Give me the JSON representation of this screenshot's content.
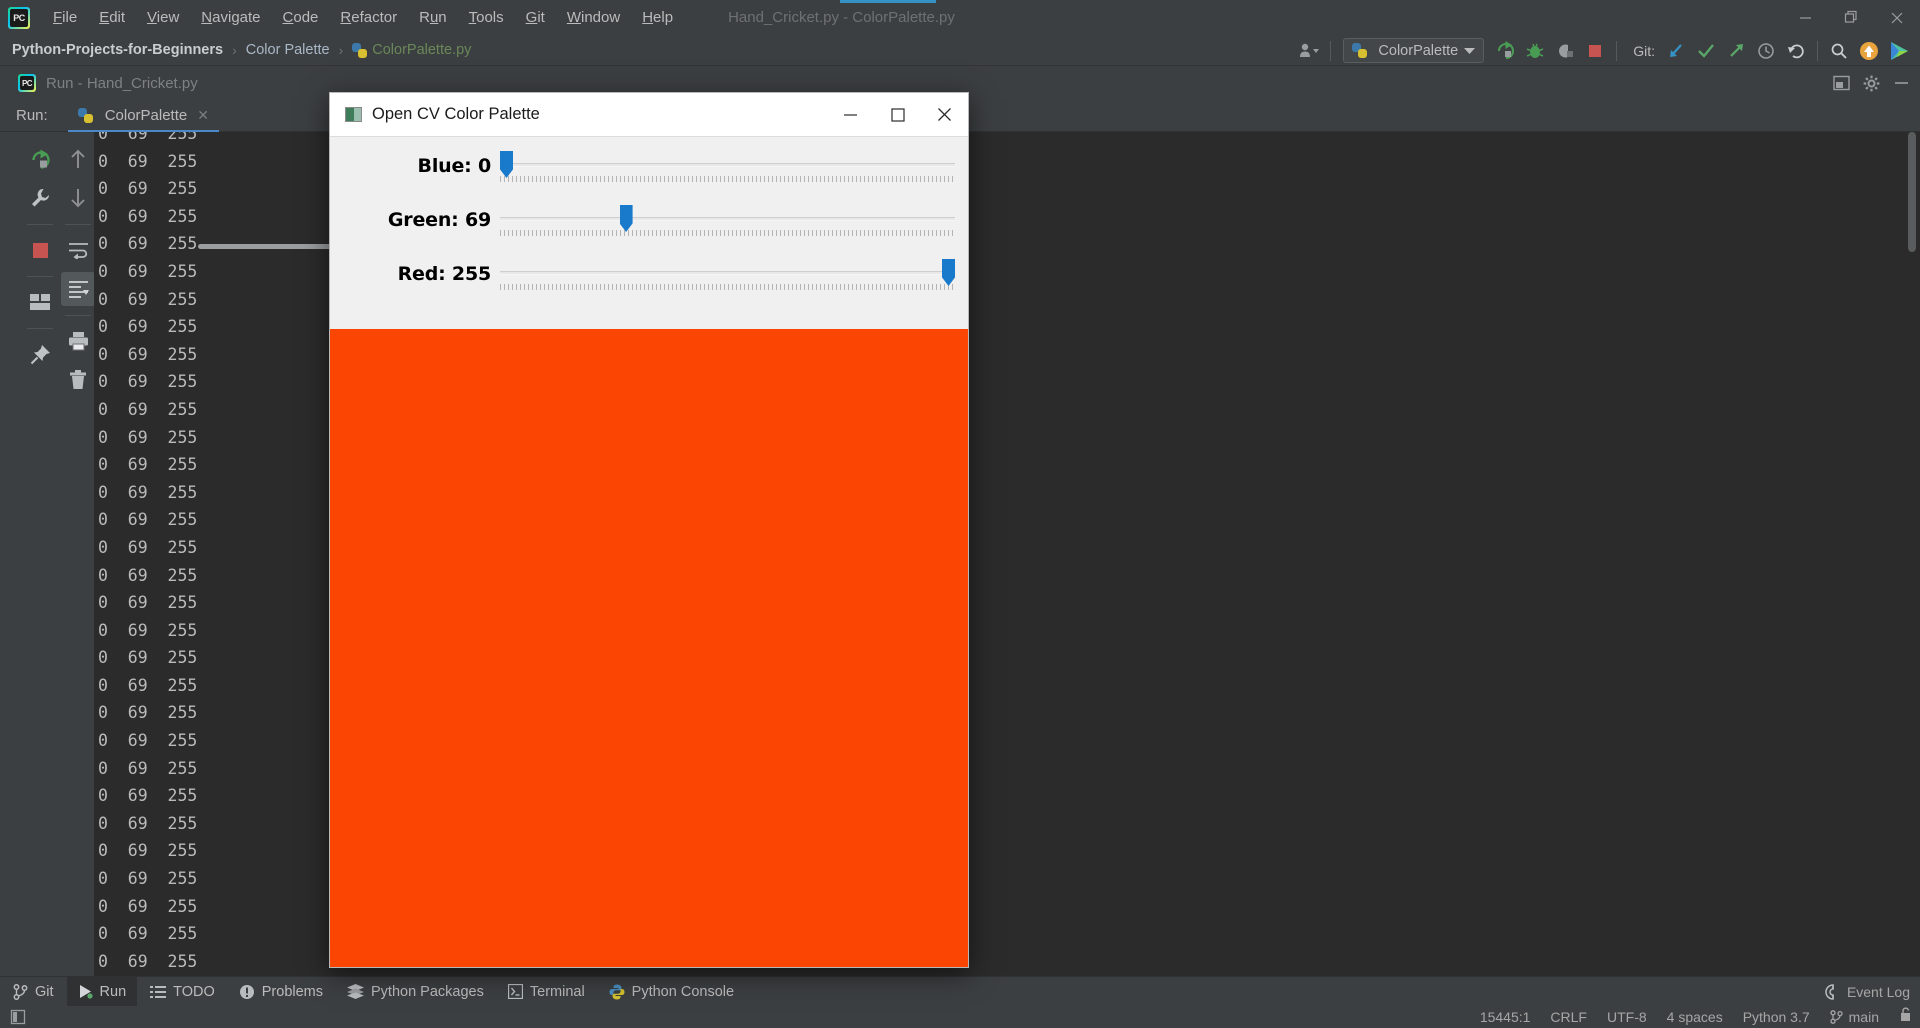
{
  "app": {
    "window_title": "Hand_Cricket.py - ColorPalette.py",
    "logo_text": "PC"
  },
  "menubar": {
    "items": [
      {
        "label": "File",
        "mnemonic": "F"
      },
      {
        "label": "Edit",
        "mnemonic": "E"
      },
      {
        "label": "View",
        "mnemonic": "V"
      },
      {
        "label": "Navigate",
        "mnemonic": "N"
      },
      {
        "label": "Code",
        "mnemonic": "C"
      },
      {
        "label": "Refactor",
        "mnemonic": "R"
      },
      {
        "label": "Run",
        "mnemonic": "u"
      },
      {
        "label": "Tools",
        "mnemonic": "T"
      },
      {
        "label": "Git",
        "mnemonic": "G"
      },
      {
        "label": "Window",
        "mnemonic": "W"
      },
      {
        "label": "Help",
        "mnemonic": "H"
      }
    ],
    "window_controls": {
      "minimize": "minimize-icon",
      "restore": "restore-icon",
      "close": "close-icon"
    }
  },
  "navbar": {
    "breadcrumbs": [
      {
        "label": "Python-Projects-for-Beginners",
        "kind": "project"
      },
      {
        "label": "Color Palette",
        "kind": "folder"
      },
      {
        "label": "ColorPalette.py",
        "kind": "file"
      }
    ],
    "separator": "›",
    "run_configuration": {
      "name": "ColorPalette",
      "icon": "python-file-icon",
      "dropdown": "chevron-down-icon"
    },
    "profile_icon": "user-settings-icon",
    "actions": [
      {
        "name": "run-button",
        "icon": "run-icon"
      },
      {
        "name": "debug-button",
        "icon": "bug-icon"
      },
      {
        "name": "run-with-coverage-button",
        "icon": "coverage-icon"
      },
      {
        "name": "stop-button",
        "icon": "stop-icon"
      }
    ],
    "git_label": "Git:",
    "git_actions": [
      {
        "name": "git-update-button",
        "icon": "update-project-icon"
      },
      {
        "name": "git-commit-button",
        "icon": "commit-icon"
      },
      {
        "name": "git-push-button",
        "icon": "push-icon"
      },
      {
        "name": "git-history-button",
        "icon": "history-icon"
      },
      {
        "name": "git-rollback-button",
        "icon": "rollback-icon"
      }
    ],
    "search_icon": "search-icon",
    "updates_icon": "update-available-icon",
    "ide_features_icon": "ide-features-trainer-icon"
  },
  "run_tool_window": {
    "header_title": "Run - Hand_Cricket.py",
    "header_icons": [
      {
        "name": "hide-tool-window-button",
        "icon": "hide-icon"
      },
      {
        "name": "settings-button",
        "icon": "gear-icon"
      },
      {
        "name": "minimize-tool-window-button",
        "icon": "minimize-icon"
      }
    ],
    "run_label": "Run:",
    "tabs": [
      {
        "label": "ColorPalette",
        "icon": "python-file-icon",
        "active": true,
        "close": "close-icon"
      }
    ],
    "left_toolbar_1": [
      {
        "name": "rerun-button",
        "icon": "rerun-icon"
      },
      {
        "name": "modify-run-configuration-button",
        "icon": "wrench-icon"
      },
      {
        "name": "stop-button",
        "icon": "stop-square-icon"
      },
      {
        "name": "restore-layout-button",
        "icon": "layout-icon"
      },
      {
        "name": "pin-tab-button",
        "icon": "pin-icon"
      }
    ],
    "left_toolbar_2": [
      {
        "name": "up-the-stack-button",
        "icon": "arrow-up-icon"
      },
      {
        "name": "down-the-stack-button",
        "icon": "arrow-down-icon"
      },
      {
        "name": "soft-wrap-button",
        "icon": "soft-wrap-icon"
      },
      {
        "name": "scroll-to-end-button",
        "icon": "scroll-to-end-icon",
        "selected": true
      },
      {
        "name": "print-button",
        "icon": "print-icon"
      },
      {
        "name": "clear-all-button",
        "icon": "trash-icon"
      }
    ],
    "console": {
      "line_text": "0  69  255",
      "line_count": 31,
      "partial_first_line": "0  69  255"
    }
  },
  "cv_window": {
    "title": "Open CV Color Palette",
    "icon": "opencv-window-icon",
    "controls": {
      "minimize": "─",
      "maximize": "☐",
      "close": "✕"
    },
    "trackbars": [
      {
        "name": "blue",
        "label": "Blue: 0",
        "value": 0,
        "max": 255
      },
      {
        "name": "green",
        "label": "Green: 69",
        "value": 69,
        "max": 255
      },
      {
        "name": "red",
        "label": "Red: 255",
        "value": 255,
        "max": 255
      }
    ],
    "canvas_color": "#fa4503"
  },
  "tool_window_bar": {
    "items": [
      {
        "label": "Git",
        "icon": "git-branch-icon",
        "active": false
      },
      {
        "label": "Run",
        "icon": "run-icon",
        "active": true
      },
      {
        "label": "TODO",
        "icon": "todo-list-icon",
        "active": false
      },
      {
        "label": "Problems",
        "icon": "problems-icon",
        "active": false
      },
      {
        "label": "Python Packages",
        "icon": "packages-icon",
        "active": false
      },
      {
        "label": "Terminal",
        "icon": "terminal-icon",
        "active": false
      },
      {
        "label": "Python Console",
        "icon": "python-console-icon",
        "active": false
      }
    ],
    "event_log": {
      "label": "Event Log",
      "icon": "event-log-icon"
    }
  },
  "status_bar": {
    "left_icon": "show-tool-windows-icon",
    "caret_position": "15445:1",
    "line_separator": "CRLF",
    "encoding": "UTF-8",
    "indent": "4 spaces",
    "interpreter": "Python 3.7",
    "branch": "main",
    "branch_icon": "git-branch-icon",
    "lock_icon": "lock-icon"
  },
  "colors": {
    "ide_bg": "#3c3f41",
    "console_bg": "#2b2b2b",
    "accent_blue": "#4a88c7",
    "slider_blue": "#1979cb",
    "canvas_orange": "#fa4503",
    "green_text": "#6a8759"
  }
}
